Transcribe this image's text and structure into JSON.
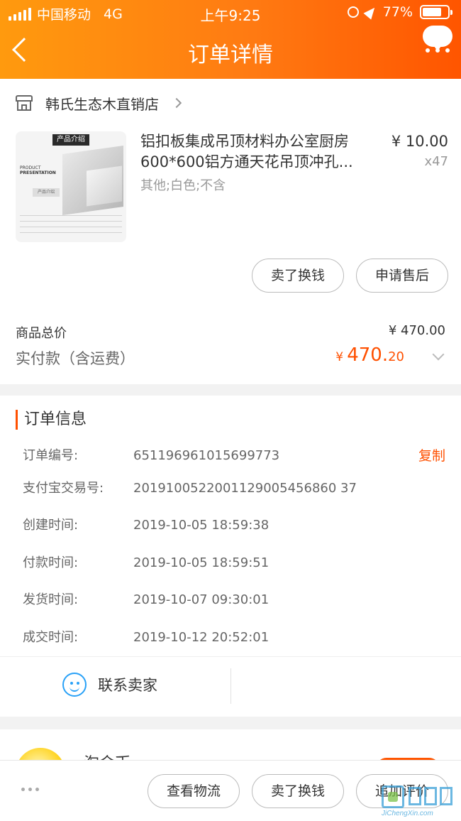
{
  "status_bar": {
    "carrier": "中国移动",
    "network": "4G",
    "time": "上午9:25",
    "battery_pct": "77%",
    "battery_level": 0.77
  },
  "nav": {
    "title": "订单详情"
  },
  "store": {
    "name": "韩氏生态木直销店"
  },
  "product": {
    "image_tag": "产品介绍",
    "image_caption_1": "PRODUCT",
    "image_caption_2": "PRESENTATION",
    "image_caption_3": "产品介绍",
    "name": "铝扣板集成吊顶材料办公室厨房600*600铝方通天花吊顶冲孔...",
    "spec": "其他;白色;不含",
    "price": "¥ 10.00",
    "qty": "x47"
  },
  "item_actions": {
    "sell_label": "卖了换钱",
    "after_sale_label": "申请售后"
  },
  "totals": {
    "goods_total_label": "商品总价",
    "goods_total_value": "¥ 470.00",
    "paid_label": "实付款（含运费）",
    "paid_currency": "¥",
    "paid_int": "470.",
    "paid_dec": "20"
  },
  "order_info": {
    "title": "订单信息",
    "copy_label": "复制",
    "rows": [
      {
        "label": "订单编号:",
        "value": "651196961015699773"
      },
      {
        "label": "支付宝交易号:",
        "value": "2019100522001129005456860 37"
      },
      {
        "label": "创建时间:",
        "value": "2019-10-05 18:59:38"
      },
      {
        "label": "付款时间:",
        "value": "2019-10-05 18:59:51"
      },
      {
        "label": "发货时间:",
        "value": "2019-10-07 09:30:01"
      },
      {
        "label": "成交时间:",
        "value": "2019-10-12 20:52:01"
      }
    ],
    "contact_label": "联系卖家"
  },
  "peek": {
    "name": "淘金币"
  },
  "bottom_bar": {
    "logistics_label": "查看物流",
    "sell_label": "卖了换钱",
    "review_label": "追加评价"
  },
  "watermark": {
    "text": "JiChengXin.com"
  },
  "colors": {
    "accent": "#ff5000",
    "header_start": "#ff9a0e",
    "header_end": "#ff5500",
    "contact_icon": "#29a1f7"
  },
  "icons": [
    "back-chevron-icon",
    "more-bubble-icon",
    "store-icon",
    "chevron-right-icon",
    "chevron-down-icon",
    "contact-smile-icon",
    "more-dots-icon"
  ]
}
